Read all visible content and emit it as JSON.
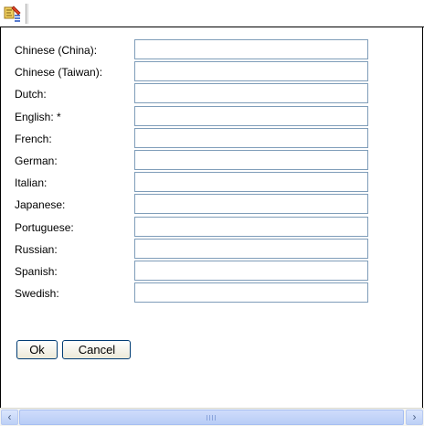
{
  "toolbar": {
    "icon": "translate-edit-icon"
  },
  "form": {
    "fields": [
      {
        "label": "Chinese (China):",
        "value": ""
      },
      {
        "label": "Chinese (Taiwan):",
        "value": ""
      },
      {
        "label": "Dutch:",
        "value": ""
      },
      {
        "label": "English: *",
        "value": ""
      },
      {
        "label": "French:",
        "value": ""
      },
      {
        "label": "German:",
        "value": ""
      },
      {
        "label": "Italian:",
        "value": ""
      },
      {
        "label": "Japanese:",
        "value": ""
      },
      {
        "label": "Portuguese:",
        "value": ""
      },
      {
        "label": "Russian:",
        "value": ""
      },
      {
        "label": "Spanish:",
        "value": ""
      },
      {
        "label": "Swedish:",
        "value": ""
      }
    ]
  },
  "buttons": {
    "ok_label": "Ok",
    "cancel_label": "Cancel"
  },
  "scrollbar": {
    "left_icon": "chevron-left-icon",
    "right_icon": "chevron-right-icon"
  },
  "colors": {
    "input_border": "#7f9db9",
    "button_border": "#003c74",
    "scrollbar_thumb": "#cfdcfb"
  }
}
